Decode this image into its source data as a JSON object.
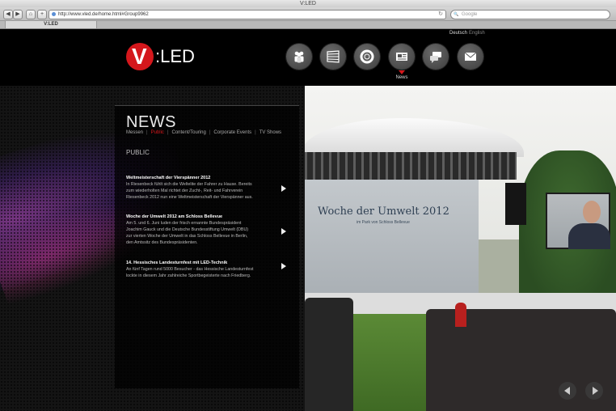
{
  "browser": {
    "window_title": "V:LED",
    "url": "http://www.vled.de/home.html#Group9962",
    "search_placeholder": "Google",
    "tab_title": "V:LED",
    "back_glyph": "◀",
    "forward_glyph": "▶",
    "home_glyph": "⌂",
    "add_glyph": "+",
    "reload_glyph": "↻",
    "search_glyph": "🔍"
  },
  "site": {
    "languages": [
      "Deutsch",
      "English"
    ],
    "logo_letter": "V",
    "logo_text": ":LED",
    "nav": {
      "items": [
        {
          "icon": "people-icon"
        },
        {
          "icon": "stage-icon"
        },
        {
          "icon": "lifebuoy-icon"
        },
        {
          "icon": "newspaper-icon",
          "active": true
        },
        {
          "icon": "chat-icon"
        },
        {
          "icon": "mail-icon"
        }
      ],
      "active_caption": "News"
    },
    "news": {
      "title": "NEWS",
      "tabs": [
        "Messen",
        "Public",
        "Content/Touring",
        "Corporate Events",
        "TV Shows"
      ],
      "active_tab": "Public",
      "section": "PUBLIC",
      "items": [
        {
          "title": "Weltmeisterschaft der Vierspänner 2012",
          "body": [
            "In Riesenbeck fühlt sich die Weltelite der Fahrer zu Hause. Bereits",
            "zum wiederholten Mal richtet der Zucht-, Reit- und Fahrverein",
            "Riesenbeck 2012 nun eine Weltmeisterschaft der Vierspänner aus."
          ]
        },
        {
          "title": "Woche der Umwelt 2012 am Schloss Bellevue",
          "body": [
            "Am 5. und 6. Juni luden der frisch ernannte Bundespräsident",
            "Joachim Gauck und die Deutsche Bundesstiftung Umwelt (DBU)",
            "zur vierten Woche der Umwelt in das Schloss Bellevue in Berlin,",
            "den Amtssitz des Bundespräsidenten."
          ]
        },
        {
          "title": "14. Hessisches Landesturnfest mit LED-Technik",
          "body": [
            "An fünf Tagen rund 5000 Besucher - das Hessische Landesturnfest",
            "lockte in diesem Jahr zahlreiche Sportbegeisterte nach Friedberg."
          ]
        }
      ]
    },
    "photo": {
      "banner_text": "Woche der Umwelt 2012",
      "banner_subtext": "im Park von Schloss Bellevue"
    },
    "slider": {
      "prev_icon": "prev-arrow-icon",
      "next_icon": "next-arrow-icon"
    },
    "colors": {
      "brand_red": "#d4171c",
      "background": "#000000"
    }
  }
}
